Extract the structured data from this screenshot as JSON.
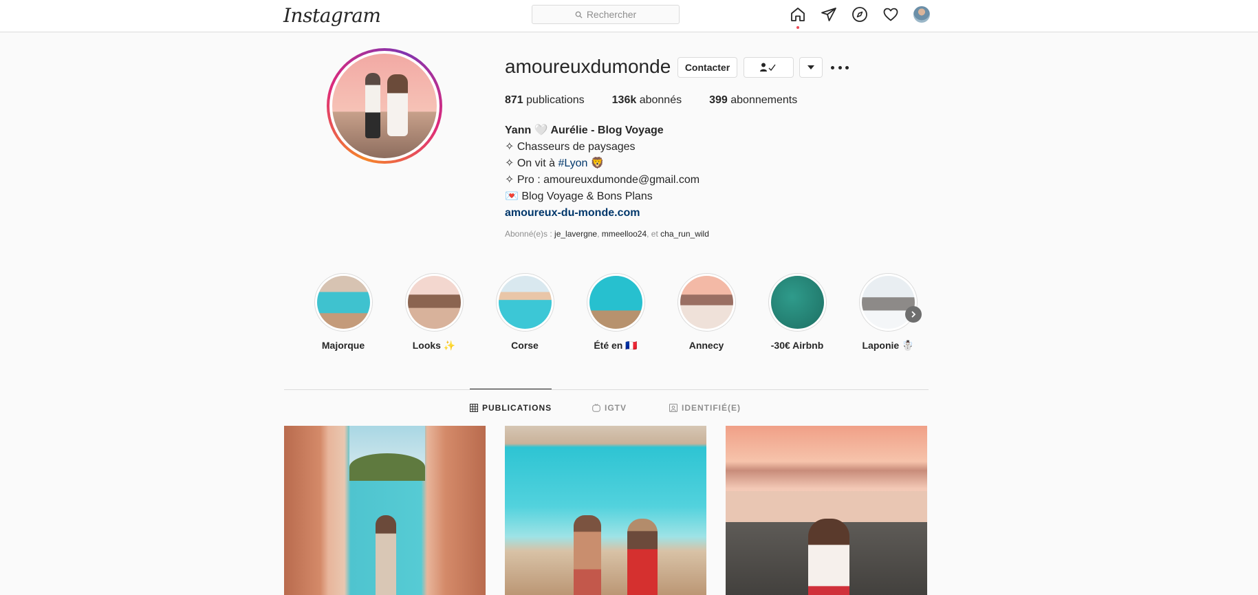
{
  "app": {
    "logo": "Instagram"
  },
  "search": {
    "placeholder": "Rechercher"
  },
  "nav": {
    "icons": [
      "home-icon",
      "direct-icon",
      "explore-icon",
      "activity-heart-icon",
      "profile-avatar"
    ]
  },
  "profile": {
    "username": "amoureuxdumonde",
    "buttons": {
      "contact": "Contacter",
      "follow_icon": "👤✓",
      "dropdown_icon": "▾"
    },
    "stats": {
      "posts_value": "871",
      "posts_label": "publications",
      "followers_value": "136k",
      "followers_label": "abonnés",
      "following_value": "399",
      "following_label": "abonnements"
    },
    "bio": {
      "name": "Yann 🤍 Aurélie - Blog Voyage",
      "line1": "✧ Chasseurs de paysages",
      "line2_prefix": "✧ On vit à ",
      "line2_tag": "#Lyon",
      "line2_suffix": " 🦁",
      "line3": "✧ Pro : amoureuxdumonde@gmail.com",
      "line4": "💌 Blog Voyage & Bons Plans",
      "website": "amoureux-du-monde.com"
    },
    "followed_by": {
      "prefix": "Abonné(e)s : ",
      "user1": "je_lavergne",
      "sep1": ", ",
      "user2": "mmeelloo24",
      "sep2": ", et ",
      "user3": "cha_run_wild"
    }
  },
  "highlights": [
    {
      "label": "Majorque"
    },
    {
      "label": "Looks ✨"
    },
    {
      "label": "Corse"
    },
    {
      "label": "Été en 🇫🇷"
    },
    {
      "label": "Annecy"
    },
    {
      "label": "-30€ Airbnb"
    },
    {
      "label": "Laponie ☃️"
    }
  ],
  "tabs": [
    {
      "label": "PUBLICATIONS",
      "active": true
    },
    {
      "label": "IGTV",
      "active": false
    },
    {
      "label": "IDENTIFIÉ(E)",
      "active": false
    }
  ],
  "colors": {
    "accent_link": "#00376b",
    "notification_dot": "#ed4956",
    "border": "#dbdbdb"
  }
}
